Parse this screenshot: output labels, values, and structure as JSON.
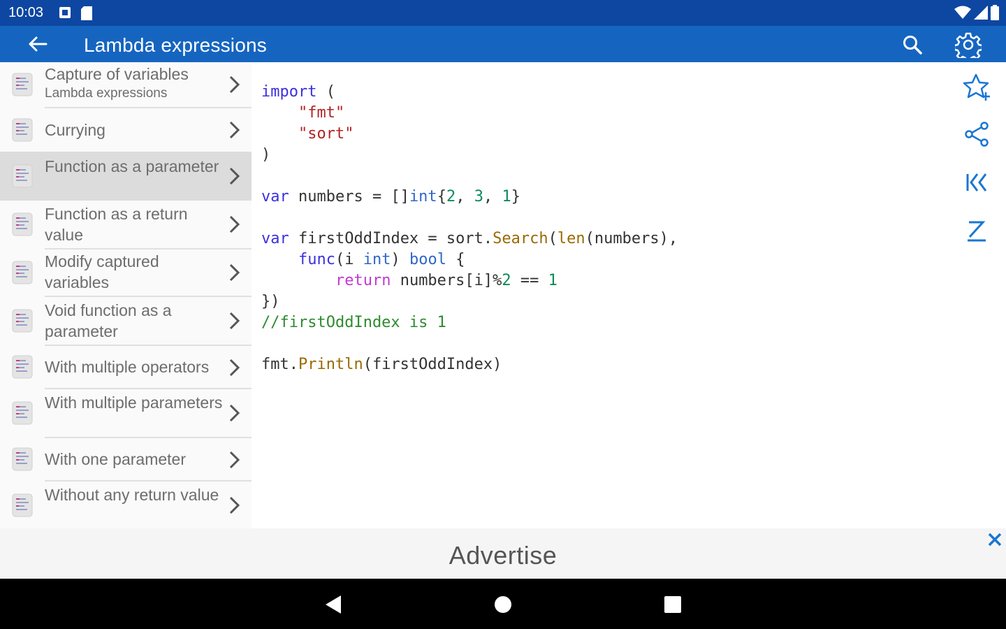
{
  "status_bar": {
    "time": "10:03"
  },
  "app_bar": {
    "title": "Lambda expressions"
  },
  "sidebar": {
    "items": [
      {
        "label": "Capture of variables",
        "sub": "Lambda expressions"
      },
      {
        "label": "Currying",
        "sub": ""
      },
      {
        "label": "Function as a parameter",
        "sub": ""
      },
      {
        "label": "Function as a return value",
        "sub": ""
      },
      {
        "label": "Modify captured variables",
        "sub": ""
      },
      {
        "label": "Void function as a parameter",
        "sub": ""
      },
      {
        "label": "With multiple operators",
        "sub": ""
      },
      {
        "label": "With multiple parameters",
        "sub": ""
      },
      {
        "label": "With one parameter",
        "sub": ""
      },
      {
        "label": "Without any return value",
        "sub": ""
      }
    ]
  },
  "code": [
    [
      {
        "t": "import",
        "c": "kw"
      },
      {
        "t": " ("
      }
    ],
    [
      {
        "t": "    "
      },
      {
        "t": "\"fmt\"",
        "c": "str"
      }
    ],
    [
      {
        "t": "    "
      },
      {
        "t": "\"sort\"",
        "c": "str"
      }
    ],
    [
      {
        "t": ")"
      }
    ],
    [
      {
        "t": ""
      }
    ],
    [
      {
        "t": "var",
        "c": "kw"
      },
      {
        "t": " numbers = []"
      },
      {
        "t": "int",
        "c": "ty"
      },
      {
        "t": "{"
      },
      {
        "t": "2",
        "c": "num"
      },
      {
        "t": ", "
      },
      {
        "t": "3",
        "c": "num"
      },
      {
        "t": ", "
      },
      {
        "t": "1",
        "c": "num"
      },
      {
        "t": "}"
      }
    ],
    [
      {
        "t": ""
      }
    ],
    [
      {
        "t": "var",
        "c": "kw"
      },
      {
        "t": " firstOddIndex = sort."
      },
      {
        "t": "Search",
        "c": "fn"
      },
      {
        "t": "("
      },
      {
        "t": "len",
        "c": "fn"
      },
      {
        "t": "(numbers),"
      }
    ],
    [
      {
        "t": "    "
      },
      {
        "t": "func",
        "c": "kw"
      },
      {
        "t": "(i "
      },
      {
        "t": "int",
        "c": "ty"
      },
      {
        "t": ") "
      },
      {
        "t": "bool",
        "c": "ty"
      },
      {
        "t": " {"
      }
    ],
    [
      {
        "t": "        "
      },
      {
        "t": "return",
        "c": "ret"
      },
      {
        "t": " numbers[i]%"
      },
      {
        "t": "2",
        "c": "num"
      },
      {
        "t": " == "
      },
      {
        "t": "1",
        "c": "num"
      }
    ],
    [
      {
        "t": "})"
      }
    ],
    [
      {
        "t": "//firstOddIndex is 1",
        "c": "cmt"
      }
    ],
    [
      {
        "t": ""
      }
    ],
    [
      {
        "t": "fmt."
      },
      {
        "t": "Println",
        "c": "fn"
      },
      {
        "t": "(firstOddIndex)"
      }
    ]
  ],
  "ad": {
    "label": "Advertise"
  },
  "icons": {
    "back": "arrow-back-icon",
    "search": "search-icon",
    "settings": "gear-icon",
    "favorite": "star-add-icon",
    "share": "share-icon",
    "first": "skip-first-icon",
    "sort": "sort-icon",
    "close": "close-icon"
  },
  "colors": {
    "status_bar": "#0d47a1",
    "app_bar": "#1565c0",
    "accent": "#1976d2",
    "selected_item": "#dcdcdc"
  }
}
